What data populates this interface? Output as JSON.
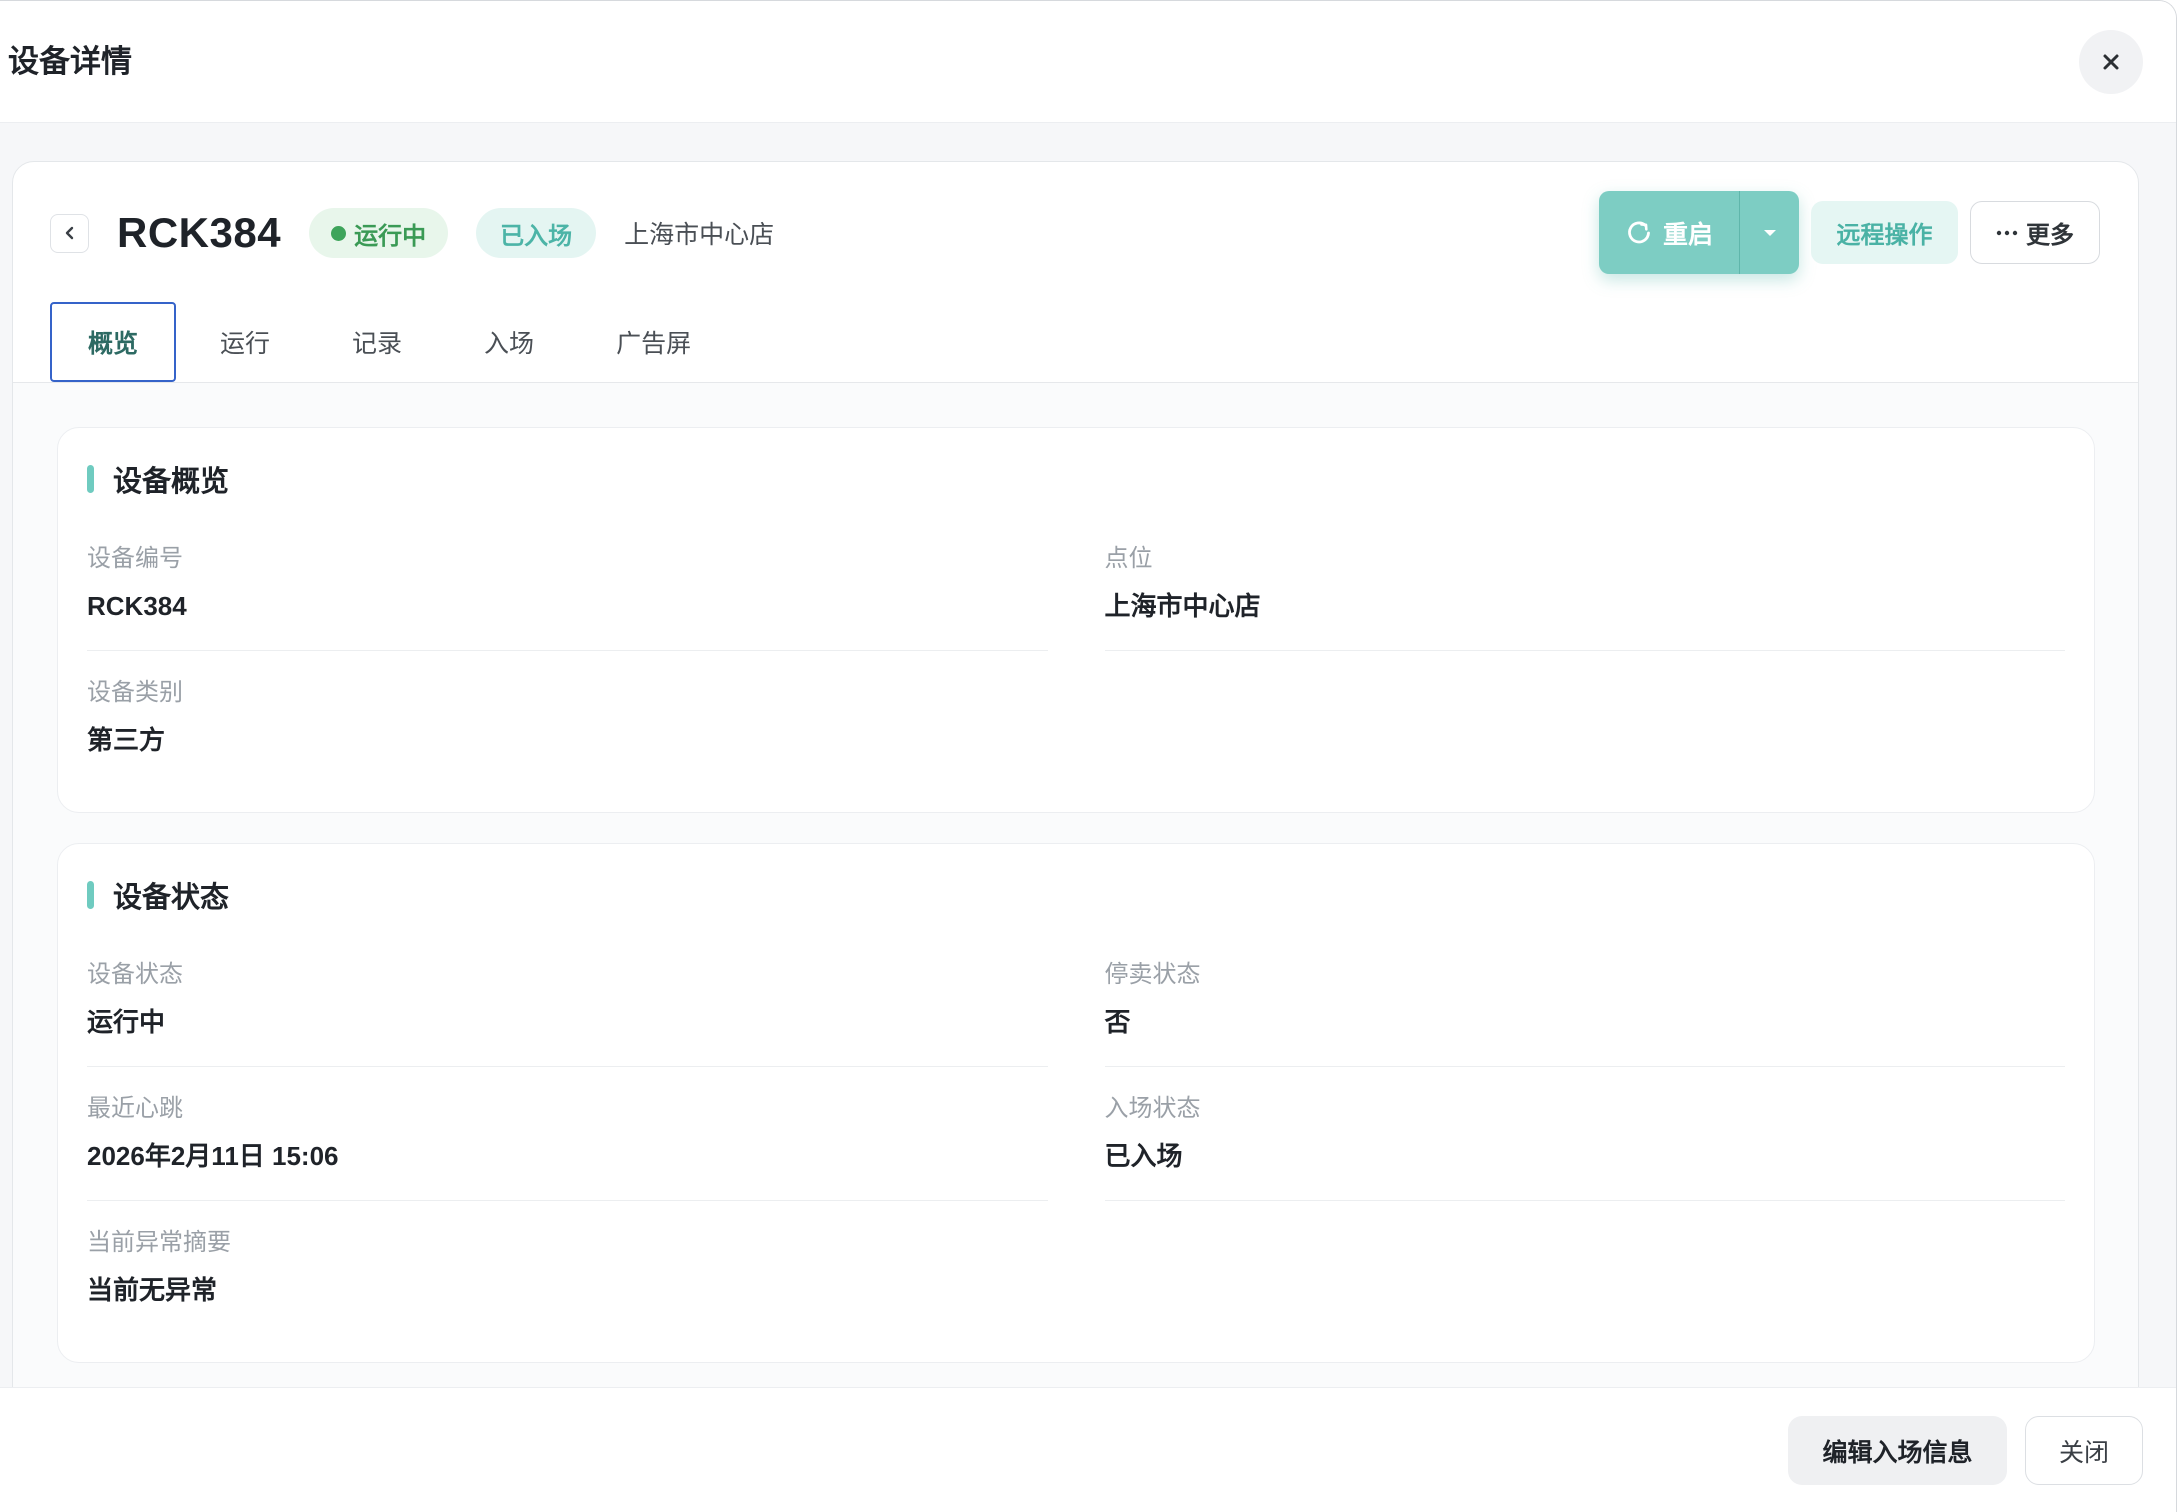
{
  "header": {
    "title": "设备详情"
  },
  "device": {
    "code": "RCK384",
    "status": "运行中",
    "entry_status": "已入场",
    "location": "上海市中心店"
  },
  "actions": {
    "restart": "重启",
    "remote": "远程操作",
    "more": "更多"
  },
  "tabs": [
    {
      "label": "概览",
      "active": true
    },
    {
      "label": "运行",
      "active": false
    },
    {
      "label": "记录",
      "active": false
    },
    {
      "label": "入场",
      "active": false
    },
    {
      "label": "广告屏",
      "active": false
    }
  ],
  "sections": [
    {
      "title": "设备概览",
      "fields": [
        {
          "label": "设备编号",
          "value": "RCK384"
        },
        {
          "label": "点位",
          "value": "上海市中心店"
        },
        {
          "label": "设备类别",
          "value": "第三方"
        }
      ]
    },
    {
      "title": "设备状态",
      "fields": [
        {
          "label": "设备状态",
          "value": "运行中"
        },
        {
          "label": "停卖状态",
          "value": "否"
        },
        {
          "label": "最近心跳",
          "value": "2026年2月11日 15:06"
        },
        {
          "label": "入场状态",
          "value": "已入场"
        },
        {
          "label": "当前异常摘要",
          "value": "当前无异常"
        }
      ]
    }
  ],
  "footer": {
    "edit": "编辑入场信息",
    "close": "关闭"
  },
  "icons": {
    "close": "close-icon",
    "back": "chevron-left-icon",
    "status": "status-dot-icon",
    "restart": "refresh-icon",
    "dropdown": "caret-down-icon",
    "more": "more-dots-icon"
  },
  "colors": {
    "primary": "#7dcdc3",
    "primary_text": "#4ab2a5",
    "running": "#3a9a55",
    "active_tab_text": "#2d6a63",
    "focus_outline": "#3563c9"
  }
}
